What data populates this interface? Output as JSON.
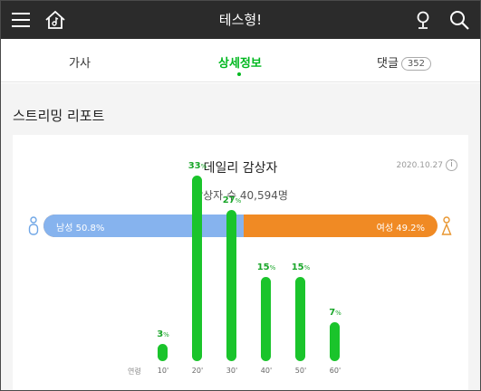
{
  "header": {
    "title": "테스형!",
    "icons": [
      "menu-icon",
      "music-home-icon",
      "mic-icon",
      "search-icon"
    ]
  },
  "tabs": [
    {
      "label": "가사",
      "active": false
    },
    {
      "label": "상세정보",
      "active": true
    },
    {
      "label": "댓글",
      "badge": "352",
      "active": false
    }
  ],
  "section": {
    "title": "스트리밍 리포트"
  },
  "card": {
    "title": "데일리 감상자",
    "date": "2020.10.27",
    "info": "i",
    "viewers": "감상자 수 40,594명",
    "gender": {
      "male_label": "남성 50.8%",
      "female_label": "여성 49.2%",
      "male_percent": 50.8,
      "female_percent": 49.2
    },
    "age_caption": "연령"
  },
  "colors": {
    "accent": "#00b81f",
    "male": "#86b3ee",
    "female": "#f08a24",
    "bar": "#1ac42b"
  },
  "chart_data": {
    "type": "bar",
    "categories": [
      "10'",
      "20'",
      "30'",
      "40'",
      "50'",
      "60'"
    ],
    "values": [
      3,
      33,
      27,
      15,
      15,
      7
    ],
    "unit": "%"
  }
}
